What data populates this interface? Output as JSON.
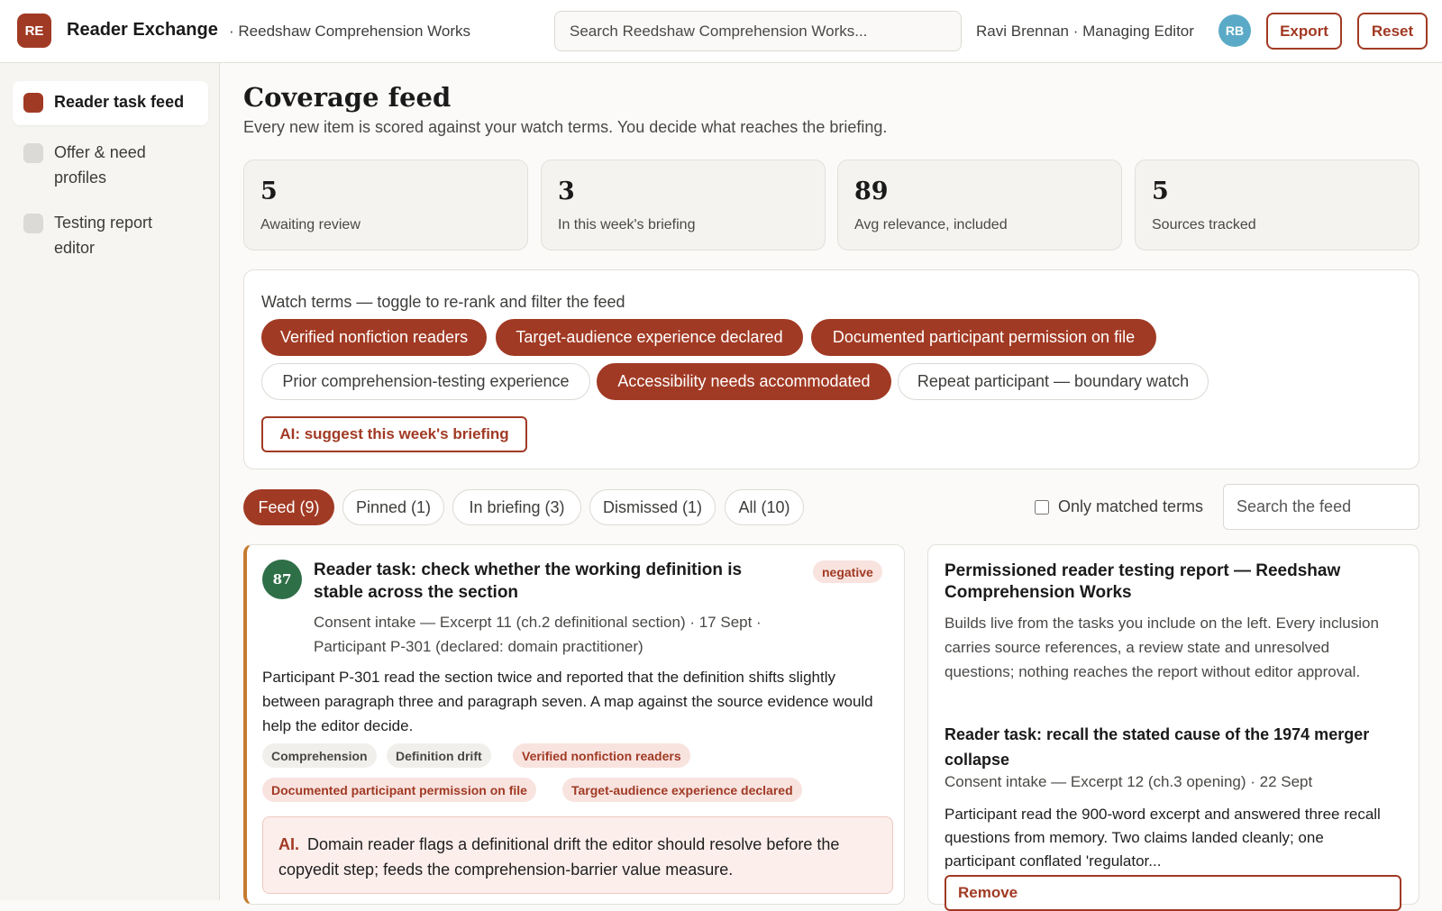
{
  "header": {
    "logo_initials": "RE",
    "app_name": "Reader Exchange",
    "workspace": "· Reedshaw Comprehension Works",
    "search_placeholder": "Search Reedshaw Comprehension Works...",
    "user": "Ravi Brennan · Managing Editor",
    "avatar_initials": "RB",
    "export_label": "Export",
    "reset_label": "Reset"
  },
  "sidebar": {
    "items": [
      {
        "label": "Reader task feed",
        "active": true
      },
      {
        "label": "Offer & need profiles",
        "active": false
      },
      {
        "label": "Testing report editor",
        "active": false
      }
    ]
  },
  "page": {
    "title": "Coverage feed",
    "subtitle": "Every new item is scored against your watch terms. You decide what reaches the briefing."
  },
  "stats": [
    {
      "value": "5",
      "label": "Awaiting review"
    },
    {
      "value": "3",
      "label": "In this week's briefing"
    },
    {
      "value": "89",
      "label": "Avg relevance, included"
    },
    {
      "value": "5",
      "label": "Sources tracked"
    }
  ],
  "watch": {
    "title": "Watch terms — toggle to re-rank and filter the feed",
    "terms": [
      {
        "label": "Verified nonfiction readers",
        "on": true
      },
      {
        "label": "Target-audience experience declared",
        "on": true
      },
      {
        "label": "Documented participant permission on file",
        "on": true
      },
      {
        "label": "Prior comprehension-testing experience",
        "on": false
      },
      {
        "label": "Accessibility needs accommodated",
        "on": true
      },
      {
        "label": "Repeat participant — boundary watch",
        "on": false
      }
    ],
    "ai_button": "AI: suggest this week's briefing"
  },
  "tabs": [
    {
      "label": "Feed (9)",
      "active": true
    },
    {
      "label": "Pinned (1)",
      "active": false
    },
    {
      "label": "In briefing (3)",
      "active": false
    },
    {
      "label": "Dismissed (1)",
      "active": false
    },
    {
      "label": "All (10)",
      "active": false
    }
  ],
  "filters": {
    "only_matched_label": "Only matched terms",
    "feed_search_placeholder": "Search the feed"
  },
  "feed_card": {
    "score": "87",
    "title": "Reader task: check whether the working definition is stable across the section",
    "sentiment": "negative",
    "meta": "Consent intake — Excerpt 11 (ch.2 definitional section) · 17 Sept · Participant P-301 (declared: domain practitioner)",
    "body": "Participant P-301 read the section twice and reported that the definition shifts slightly between paragraph three and paragraph seven. A map against the source evidence would help the editor decide.",
    "tags": [
      {
        "label": "Comprehension",
        "match": false
      },
      {
        "label": "Definition drift",
        "match": false
      },
      {
        "label": "Verified nonfiction readers",
        "match": true
      },
      {
        "label": "Documented participant permission on file",
        "match": true
      },
      {
        "label": "Target-audience experience declared",
        "match": true
      }
    ],
    "ai_label": "AI.",
    "ai_text": "Domain reader flags a definitional drift the editor should resolve before the copyedit step; feeds the comprehension-barrier value measure."
  },
  "report": {
    "title": "Permissioned reader testing report — Reedshaw Comprehension Works",
    "description": "Builds live from the tasks you include on the left. Every inclusion carries source references, a review state and unresolved questions; nothing reaches the report without editor approval.",
    "inclusion_title": "Reader task: recall the stated cause of the 1974 merger collapse",
    "inclusion_meta": "Consent intake — Excerpt 12 (ch.3 opening) · 22 Sept",
    "inclusion_body": "Participant read the 900-word excerpt and answered three recall questions from memory. Two claims landed cleanly; one participant conflated 'regulator...",
    "remove_label": "Remove"
  },
  "colors": {
    "accent": "#a13a24",
    "score_high": "#2f6f47",
    "avatar": "#5aaac7",
    "card_highlight": "#c57b2e"
  }
}
